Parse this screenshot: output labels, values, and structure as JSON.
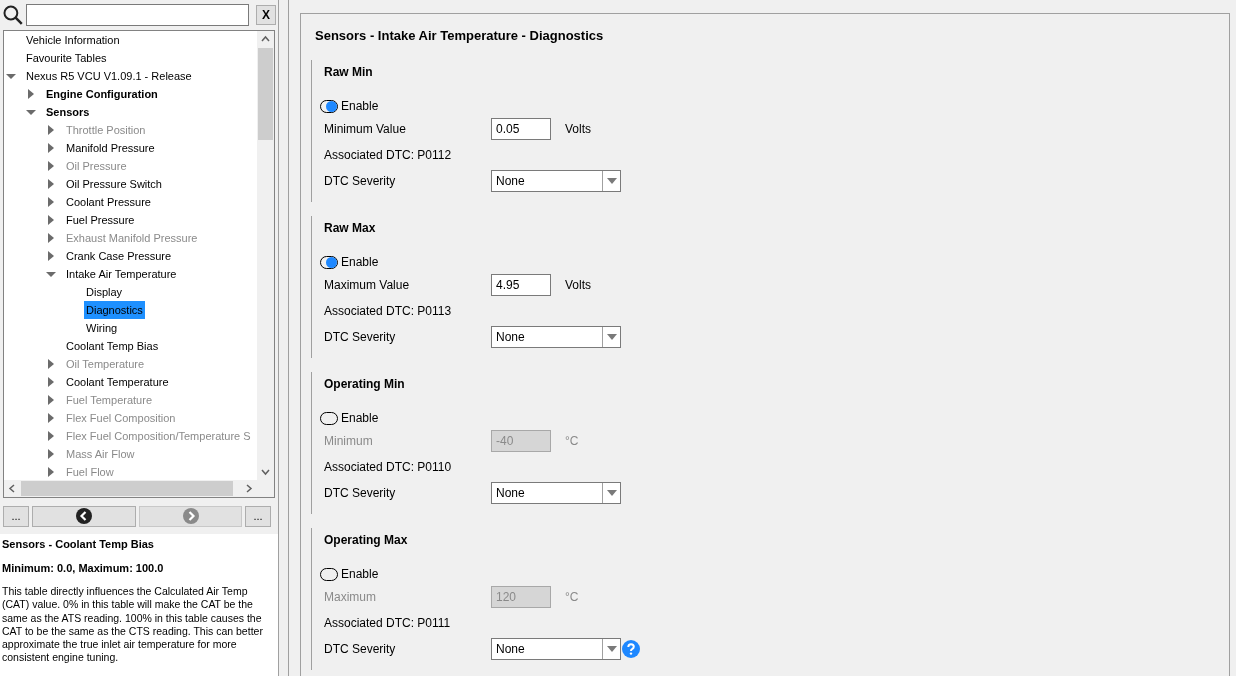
{
  "search": {
    "clear_label": "X"
  },
  "tree": [
    {
      "label": "Vehicle Information",
      "bold": false,
      "disabled": false,
      "selected": false
    },
    {
      "label": "Favourite Tables",
      "bold": false,
      "disabled": false,
      "selected": false
    },
    {
      "label": "Nexus R5 VCU V1.09.1 - Release",
      "bold": false,
      "disabled": false,
      "selected": false,
      "expanded": true,
      "children": [
        {
          "label": "Engine Configuration",
          "bold": true,
          "disabled": false,
          "selected": false,
          "expanded": false
        },
        {
          "label": "Sensors",
          "bold": true,
          "disabled": false,
          "selected": false,
          "expanded": true,
          "children": [
            {
              "label": "Throttle Position",
              "bold": false,
              "disabled": true,
              "selected": false,
              "expanded": false
            },
            {
              "label": "Manifold Pressure",
              "bold": false,
              "disabled": false,
              "selected": false,
              "expanded": false
            },
            {
              "label": "Oil Pressure",
              "bold": false,
              "disabled": true,
              "selected": false,
              "expanded": false
            },
            {
              "label": "Oil Pressure Switch",
              "bold": false,
              "disabled": false,
              "selected": false,
              "expanded": false
            },
            {
              "label": "Coolant Pressure",
              "bold": false,
              "disabled": false,
              "selected": false,
              "expanded": false
            },
            {
              "label": "Fuel Pressure",
              "bold": false,
              "disabled": false,
              "selected": false,
              "expanded": false
            },
            {
              "label": "Exhaust Manifold Pressure",
              "bold": false,
              "disabled": true,
              "selected": false,
              "expanded": false
            },
            {
              "label": "Crank Case Pressure",
              "bold": false,
              "disabled": false,
              "selected": false,
              "expanded": false
            },
            {
              "label": "Intake Air Temperature",
              "bold": false,
              "disabled": false,
              "selected": false,
              "expanded": true,
              "children": [
                {
                  "label": "Display",
                  "bold": false,
                  "disabled": false,
                  "selected": false
                },
                {
                  "label": "Diagnostics",
                  "bold": false,
                  "disabled": false,
                  "selected": true
                },
                {
                  "label": "Wiring",
                  "bold": false,
                  "disabled": false,
                  "selected": false
                }
              ]
            },
            {
              "label": "Coolant Temp Bias",
              "bold": false,
              "disabled": false,
              "selected": false
            },
            {
              "label": "Oil Temperature",
              "bold": false,
              "disabled": true,
              "selected": false,
              "expanded": false
            },
            {
              "label": "Coolant Temperature",
              "bold": false,
              "disabled": false,
              "selected": false,
              "expanded": false
            },
            {
              "label": "Fuel Temperature",
              "bold": false,
              "disabled": true,
              "selected": false,
              "expanded": false
            },
            {
              "label": "Flex Fuel Composition",
              "bold": false,
              "disabled": true,
              "selected": false,
              "expanded": false
            },
            {
              "label": "Flex Fuel Composition/Temperature S",
              "bold": false,
              "disabled": true,
              "selected": false,
              "expanded": false
            },
            {
              "label": "Mass Air Flow",
              "bold": false,
              "disabled": true,
              "selected": false,
              "expanded": false
            },
            {
              "label": "Fuel Flow",
              "bold": false,
              "disabled": true,
              "selected": false,
              "expanded": false
            }
          ]
        }
      ]
    }
  ],
  "nav": {
    "left_more": "...",
    "right_more": "...",
    "back_disabled": false,
    "forward_disabled": true
  },
  "help": {
    "title": "Sensors - Coolant Temp Bias",
    "range": "Minimum: 0.0, Maximum: 100.0",
    "body": "This table directly influences the Calculated Air Temp (CAT) value. 0% in this table will make the CAT be the same as the ATS reading. 100% in this table causes the CAT to be the same as the CTS reading. This can better approximate the true inlet air temperature for more consistent engine tuning."
  },
  "page": {
    "title": "Sensors - Intake Air Temperature - Diagnostics",
    "sections": [
      {
        "title": "Raw Min",
        "enable_label": "Enable",
        "on": true,
        "value_label": "Minimum Value",
        "value": "0.05",
        "unit": "Volts",
        "dtc": "Associated DTC: P0112",
        "severity_label": "DTC Severity",
        "severity": "None",
        "help_icon": false
      },
      {
        "title": "Raw Max",
        "enable_label": "Enable",
        "on": true,
        "value_label": "Maximum Value",
        "value": "4.95",
        "unit": "Volts",
        "dtc": "Associated DTC: P0113",
        "severity_label": "DTC Severity",
        "severity": "None",
        "help_icon": false
      },
      {
        "title": "Operating Min",
        "enable_label": "Enable",
        "on": false,
        "value_label": "Minimum",
        "value": "-40",
        "unit": "°C",
        "dtc": "Associated DTC: P0110",
        "severity_label": "DTC Severity",
        "severity": "None",
        "help_icon": false
      },
      {
        "title": "Operating Max",
        "enable_label": "Enable",
        "on": false,
        "value_label": "Maximum",
        "value": "120",
        "unit": "°C",
        "dtc": "Associated DTC: P0111",
        "severity_label": "DTC Severity",
        "severity": "None",
        "help_icon": true
      }
    ]
  }
}
